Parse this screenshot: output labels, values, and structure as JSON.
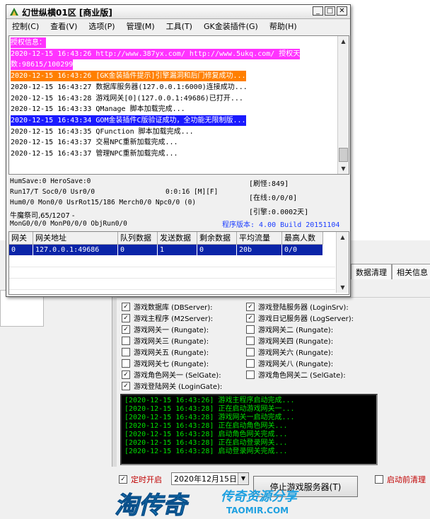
{
  "main_window": {
    "title": "幻世纵横01区 [商业版]",
    "menu": [
      "控制(C)",
      "查看(V)",
      "选项(P)",
      "管理(M)",
      "工具(T)",
      "GK金装插件(G)",
      "帮助(H)"
    ],
    "log_lines": [
      {
        "text": "授权信息：",
        "color": "#ffffff",
        "bg": "#ff33ff"
      },
      {
        "text": "2020-12-15 16:43:26 http://www.387yx.com/ http://www.5ukq.com/ 授权天",
        "color": "#ffffff",
        "bg": "#ff33ff"
      },
      {
        "text": "数:98615/100299",
        "color": "#ffffff",
        "bg": "#ff33ff"
      },
      {
        "text": "2020-12-15 16:43:26 [GK金装插件提示]引擎漏洞和后门修复成功...",
        "color": "#ffffff",
        "bg": "#ff7f00"
      },
      {
        "text": "2020-12-15 16:43:27 数据库服务器(127.0.0.1:6000)连接成功...",
        "color": "#000000",
        "bg": ""
      },
      {
        "text": "2020-12-15 16:43:28 游戏网关[0](127.0.0.1:49686)已打开...",
        "color": "#000000",
        "bg": ""
      },
      {
        "text": "2020-12-15 16:43:33 QManage 脚本加载完成...",
        "color": "#000000",
        "bg": ""
      },
      {
        "text": "2020-12-15 16:43:34 GOM金装插件C版验证成功，全功能无限制版...",
        "color": "#ffffff",
        "bg": "#1a1aff"
      },
      {
        "text": "2020-12-15 16:43:35 QFunction 脚本加载完成...",
        "color": "#000000",
        "bg": ""
      },
      {
        "text": "2020-12-15 16:43:37 交易NPC重新加载完成...",
        "color": "#000000",
        "bg": ""
      },
      {
        "text": "2020-12-15 16:43:37 管理NPC重新加载完成...",
        "color": "#000000",
        "bg": ""
      }
    ],
    "stats": {
      "line1": "HumSave:0 HeroSave:0",
      "line2": "Run17/T Soc0/0 Usr0/0",
      "line2_time": "0:0:16 [M][F]",
      "line3": "Hum0/0 Mon0/0 UsrRot15/186 Merch0/0 Npc0/0 (0)",
      "line4": "牛魔祭司,65/1207 -",
      "line5": "MonG0/0/0 MonP0/0/0 ObjRun0/0",
      "refresh": "[刷怪:849]",
      "online": "[在线:0/0/0]",
      "engine": "[引擎:0.0002天]",
      "version": "程序版本: 4.00 Build 20151104",
      "version_color": "#1a3cff"
    },
    "gateway_table": {
      "headers": [
        "网关",
        "网关地址",
        "队列数据",
        "发送数据",
        "剩余数据",
        "平均流量",
        "最高人数"
      ],
      "row": [
        "0",
        "127.0.0.1:49686",
        "0",
        "1",
        "0",
        "20b",
        "0/0"
      ]
    }
  },
  "launcher": {
    "tabs": [
      "数据清理",
      "相关信息"
    ],
    "checkboxes_left": [
      {
        "label": "游戏数据库 (DBServer):",
        "checked": true
      },
      {
        "label": "游戏主程序 (M2Server):",
        "checked": true
      },
      {
        "label": "游戏网关一 (Rungate):",
        "checked": true
      },
      {
        "label": "游戏网关三 (Rungate):",
        "checked": false
      },
      {
        "label": "游戏网关五 (Rungate):",
        "checked": false
      },
      {
        "label": "游戏网关七 (Rungate):",
        "checked": false
      },
      {
        "label": "游戏角色网关一 (SelGate):",
        "checked": true
      },
      {
        "label": "游戏登陆网关 (LoginGate):",
        "checked": true
      }
    ],
    "checkboxes_right": [
      {
        "label": "游戏登陆服务器 (LoginSrv):",
        "checked": true
      },
      {
        "label": "游戏日记服务器 (LogServer):",
        "checked": true
      },
      {
        "label": "游戏网关二 (Rungate):",
        "checked": false
      },
      {
        "label": "游戏网关四 (Rungate):",
        "checked": false
      },
      {
        "label": "游戏网关六 (Rungate):",
        "checked": false
      },
      {
        "label": "游戏网关八 (Rungate):",
        "checked": false
      },
      {
        "label": "游戏角色网关二 (SelGate):",
        "checked": false
      }
    ],
    "log_lines": [
      "[2020-12-15 16:43:26] 游戏主程序启动完成...",
      "[2020-12-15 16:43:28] 正在启动游戏网关一...",
      "[2020-12-15 16:43:28] 游戏网关一启动完成...",
      "[2020-12-15 16:43:28] 正在启动角色网关...",
      "[2020-12-15 16:43:28] 启动角色网关完成...",
      "[2020-12-15 16:43:28] 正在启动登录网关...",
      "[2020-12-15 16:43:28] 启动登录网关完成..."
    ],
    "timer_label": "定时开启",
    "timer_checked": true,
    "date_value": "2020年12月15日",
    "stop_button": "停止游戏服务器(T)",
    "pre_clean_label": "启动前清理",
    "watermark_main": "淘传奇",
    "watermark_sub": "传奇资源分享",
    "watermark_url": "TAOMIR.COM"
  }
}
